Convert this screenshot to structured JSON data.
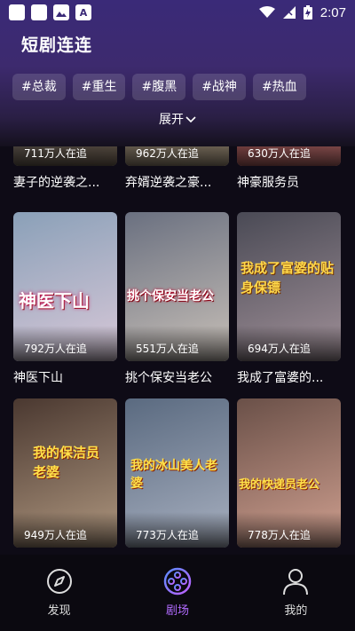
{
  "status": {
    "time": "2:07"
  },
  "app_title": "短剧连连",
  "tags": [
    "#总裁",
    "#重生",
    "#腹黑",
    "#战神",
    "#热血"
  ],
  "expand_label": "展开",
  "rows": [
    {
      "cards": [
        {
          "views": "711万人在追",
          "title": "妻子的逆袭之...",
          "colors": [
            "#3a3f48",
            "#7a6a5a"
          ]
        },
        {
          "views": "962万人在追",
          "title": "弃婿逆袭之豪...",
          "colors": [
            "#5a5048",
            "#a89880"
          ]
        },
        {
          "views": "630万人在追",
          "title": "神豪服务员",
          "colors": [
            "#6a2a2a",
            "#c07070"
          ]
        }
      ]
    },
    {
      "cards": [
        {
          "views": "792万人在追",
          "title": "神医下山",
          "colors": [
            "#8aa0b8",
            "#d8c8d8"
          ],
          "poster_text": "神医下山"
        },
        {
          "views": "551万人在追",
          "title": "挑个保安当老公",
          "colors": [
            "#6a7080",
            "#c8c0b8"
          ],
          "poster_text": "挑个保安当老公"
        },
        {
          "views": "694万人在追",
          "title": "我成了富婆的...",
          "colors": [
            "#4a4a55",
            "#a09098"
          ],
          "poster_text": "我成了富婆的贴身保镖"
        }
      ]
    },
    {
      "cards": [
        {
          "views": "949万人在追",
          "title": "",
          "colors": [
            "#4a3830",
            "#b09880"
          ],
          "poster_text": "我的保洁员老婆"
        },
        {
          "views": "773万人在追",
          "title": "",
          "colors": [
            "#5a6a80",
            "#a8b0c0"
          ],
          "poster_text": "我的冰山美人老婆"
        },
        {
          "views": "778万人在追",
          "title": "",
          "colors": [
            "#6a5048",
            "#d0a090"
          ],
          "poster_text": "我的快递员老公"
        }
      ]
    }
  ],
  "nav": [
    {
      "label": "发现",
      "icon": "compass-icon",
      "active": false
    },
    {
      "label": "剧场",
      "icon": "film-reel-icon",
      "active": true
    },
    {
      "label": "我的",
      "icon": "person-icon",
      "active": false
    }
  ],
  "accent_color": "#b26bff"
}
